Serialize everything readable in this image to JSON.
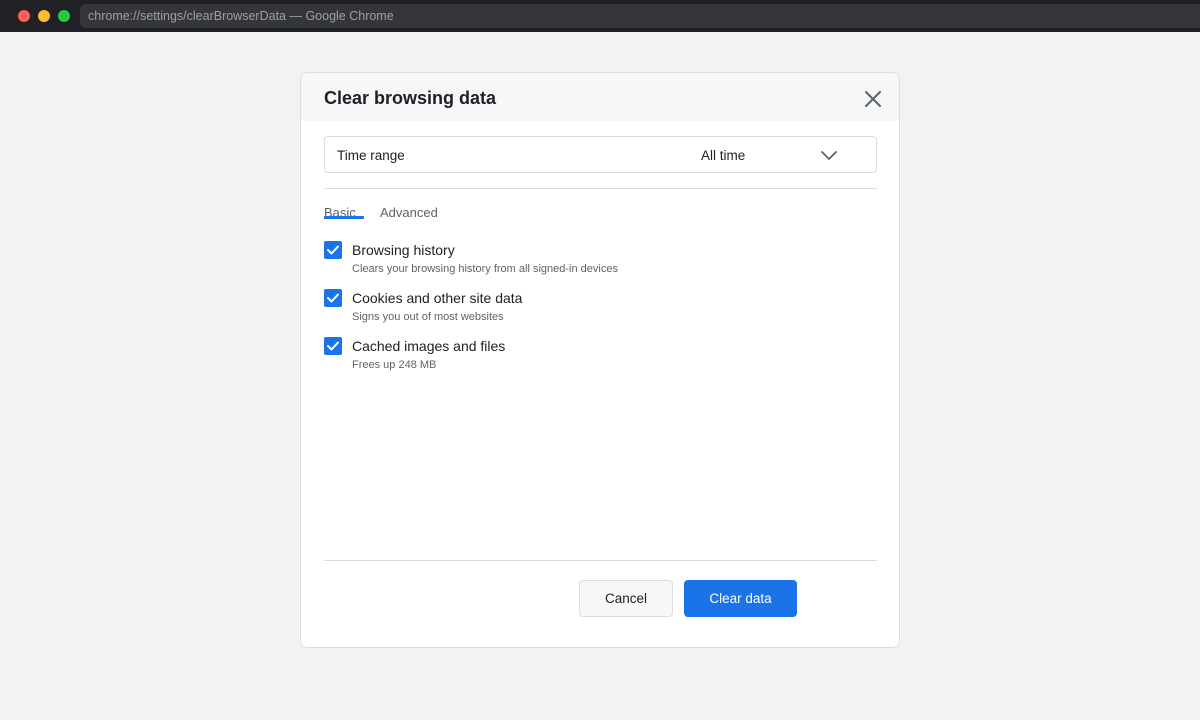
{
  "window": {
    "address": "chrome://settings/clearBrowserData — Google Chrome"
  },
  "dialog": {
    "title": "Clear browsing data",
    "time_range": {
      "label": "Time range",
      "value": "All time"
    },
    "tabs": [
      {
        "label": "Basic",
        "selected": true
      },
      {
        "label": "Advanced",
        "selected": false
      }
    ],
    "options": [
      {
        "label": "Browsing history",
        "description": "Clears your browsing history from all signed-in devices",
        "checked": true
      },
      {
        "label": "Cookies and other site data",
        "description": "Signs you out of most websites",
        "checked": true
      },
      {
        "label": "Cached images and files",
        "description": "Frees up 248 MB",
        "checked": true
      }
    ],
    "buttons": {
      "cancel": "Cancel",
      "clear": "Clear data"
    }
  },
  "colors": {
    "accent": "#1a73e8",
    "titlebar": "#202124",
    "background": "#f1f2f4"
  },
  "icons": {
    "close": "close-icon",
    "dropdown": "chevron-down-icon",
    "check": "checkmark-icon"
  }
}
